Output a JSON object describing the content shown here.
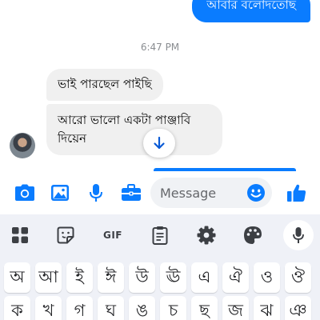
{
  "chat": {
    "outgoing_message": "আবার বলোদতোছ",
    "timestamp": "6:47 PM",
    "incoming_messages": [
      "ভাই পারছেল পাইছি",
      "আরো ভালো একটা পাঞ্জাবি দিয়েন"
    ],
    "accent_color": "#0a7cff"
  },
  "composer": {
    "placeholder": "Message",
    "icons": [
      "camera-icon",
      "gallery-icon",
      "microphone-icon",
      "briefcase-icon",
      "emoji-icon",
      "thumbs-up-icon"
    ]
  },
  "keyboard": {
    "toolbar": {
      "gif_label": "GIF",
      "icons": [
        "apps-grid-icon",
        "sticker-icon",
        "gif-icon",
        "clipboard-icon",
        "settings-gear-icon",
        "theme-palette-icon",
        "voice-input-icon"
      ]
    },
    "row1": [
      "অ",
      "আ",
      "ই",
      "ঈ",
      "উ",
      "ঊ",
      "এ",
      "ঐ",
      "ও",
      "ঔ"
    ],
    "row2": [
      "ক",
      "খ",
      "গ",
      "ঘ",
      "ঙ",
      "চ",
      "ছ",
      "জ",
      "ঝ",
      "ঞ"
    ]
  }
}
